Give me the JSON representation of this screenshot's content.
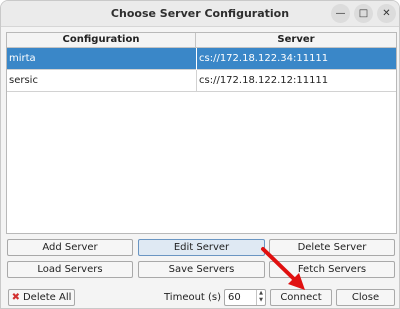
{
  "window": {
    "title": "Choose Server Configuration",
    "minimize_glyph": "—",
    "maximize_glyph": "□",
    "close_glyph": "✕"
  },
  "table": {
    "columns": [
      "Configuration",
      "Server"
    ],
    "rows": [
      {
        "configuration": "mirta",
        "server": "cs://172.18.122.34:11111",
        "selected": true
      },
      {
        "configuration": "sersic",
        "server": "cs://172.18.122.12:11111",
        "selected": false
      }
    ]
  },
  "buttons": {
    "add_server": "Add Server",
    "edit_server": "Edit Server",
    "delete_server": "Delete Server",
    "load_servers": "Load Servers",
    "save_servers": "Save Servers",
    "fetch_servers": "Fetch Servers",
    "delete_all": "Delete All",
    "connect": "Connect",
    "close": "Close"
  },
  "timeout": {
    "label": "Timeout (s)",
    "value": "60"
  },
  "icons": {
    "delete_all": "x-icon",
    "annotation": "red-arrow-icon"
  },
  "colors": {
    "selection": "#3a87c8",
    "annotation_arrow": "#e01010",
    "delete_icon": "#d23030"
  }
}
